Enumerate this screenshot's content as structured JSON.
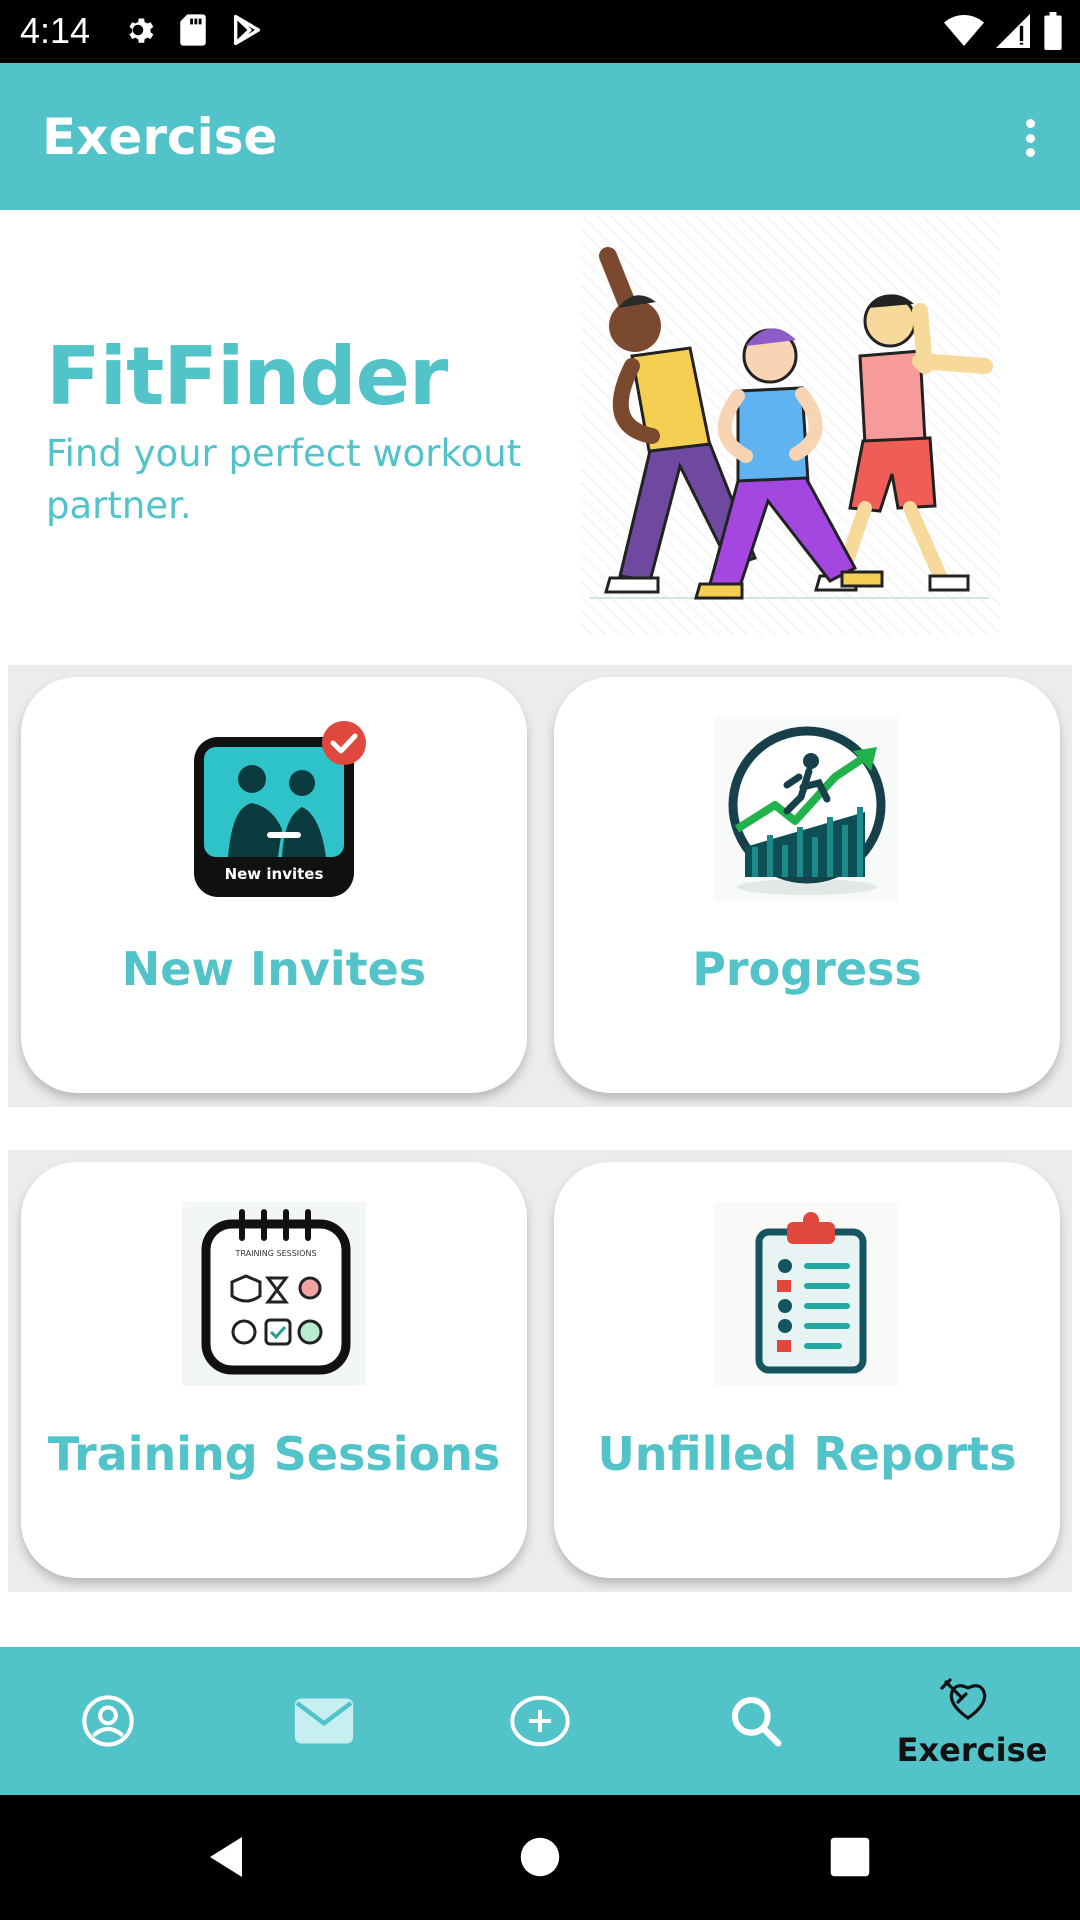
{
  "status_bar": {
    "time": "4:14",
    "icons_left": [
      "settings-icon",
      "sd-card-icon",
      "play-store-icon"
    ],
    "icons_right": [
      "wifi-icon",
      "cell-signal-icon",
      "battery-icon"
    ]
  },
  "app_bar": {
    "title": "Exercise",
    "overflow_icon": "more-vert-icon"
  },
  "hero": {
    "title": "FitFinder",
    "subtitle": "Find your perfect workout partner.",
    "illustration": "people-exercising-illustration"
  },
  "cards": [
    {
      "label": "New Invites",
      "icon": "new-invites-icon",
      "icon_text": "New invites",
      "badge": "check-badge-icon"
    },
    {
      "label": "Progress",
      "icon": "progress-chart-icon"
    },
    {
      "label": "Training Sessions",
      "icon": "training-sessions-calendar-icon",
      "icon_text": "TRAINING SESSIONS"
    },
    {
      "label": "Unfilled Reports",
      "icon": "clipboard-checklist-icon"
    }
  ],
  "bottom_nav": {
    "items": [
      {
        "icon": "profile-icon",
        "label": ""
      },
      {
        "icon": "mail-icon",
        "label": ""
      },
      {
        "icon": "add-circle-icon",
        "label": ""
      },
      {
        "icon": "search-icon",
        "label": ""
      },
      {
        "icon": "dumbbell-heart-icon",
        "label": "Exercise",
        "active": true
      }
    ]
  },
  "system_nav": {
    "back": "back-icon",
    "home": "home-icon",
    "recents": "recents-icon"
  },
  "colors": {
    "accent": "#52c3c9",
    "status_bar": "#000000",
    "card_row_bg": "#ececec",
    "badge_red": "#e0483d"
  }
}
